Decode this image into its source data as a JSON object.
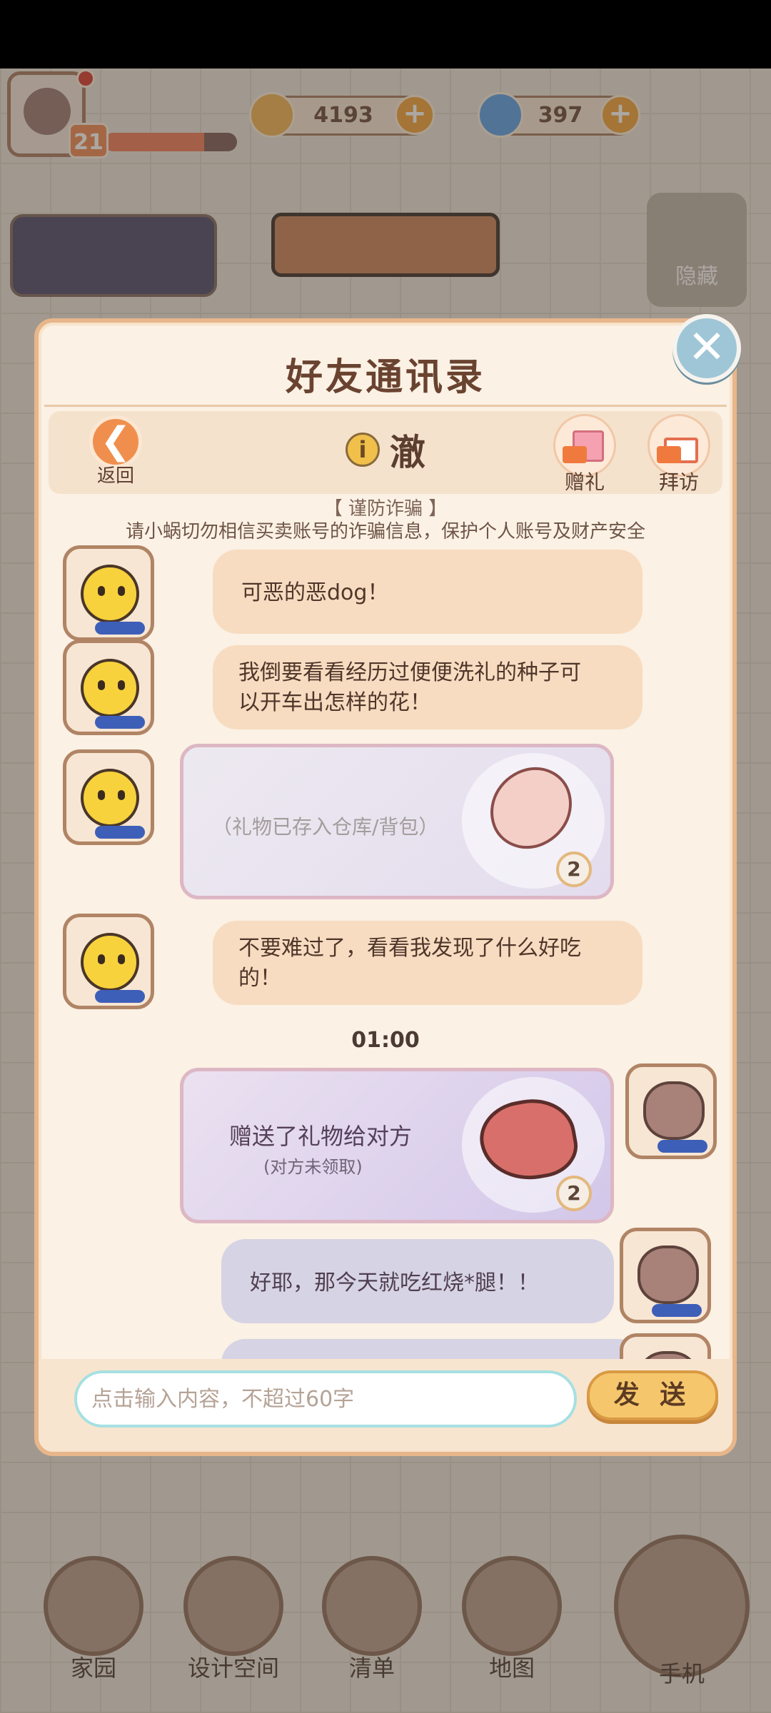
{
  "status": {},
  "player": {
    "level": "21",
    "level_progress": 0.75
  },
  "currency": {
    "coins": "4193",
    "gems": "397"
  },
  "background": {
    "hide_label": "隐藏",
    "nav": [
      {
        "label": "家园"
      },
      {
        "label": "设计空间"
      },
      {
        "label": "清单"
      },
      {
        "label": "地图"
      },
      {
        "label": "手机"
      }
    ]
  },
  "dialog": {
    "title": "好友通讯录",
    "back_label": "返回",
    "info_icon": "i",
    "friend_name": "澈",
    "gift_label": "赠礼",
    "visit_label": "拜访",
    "warning_title": "【 谨防诈骗 】",
    "warning_text": "请小蜗切勿相信买卖账号的诈骗信息，保护个人账号及财产安全",
    "close_icon": "✕",
    "back_icon": "❮"
  },
  "messages": [
    {
      "from": "friend",
      "type": "text",
      "text": "可恶的恶dog！"
    },
    {
      "from": "friend",
      "type": "text",
      "line1": "我倒要看看经历过便便洗礼的种子可",
      "line2": "以开车出怎样的花！"
    },
    {
      "from": "friend",
      "type": "gift",
      "text": "（礼物已存入仓库/背包）",
      "item": "drumstick",
      "qty": "2"
    },
    {
      "from": "friend",
      "type": "text",
      "line1": "不要难过了，看看我发现了什么好吃",
      "line2": "的！"
    },
    {
      "from": "me",
      "type": "gift",
      "text": "赠送了礼物给对方",
      "sub": "(对方未领取)",
      "item": "steak",
      "qty": "2"
    },
    {
      "from": "me",
      "type": "text",
      "text": "好耶，那今天就吃红烧*腿！！"
    }
  ],
  "time_separator": "01:00",
  "composer": {
    "placeholder": "点击输入内容，不超过60字",
    "value": "",
    "send_label": "发 送"
  },
  "colors": {
    "panel": "#fbf1e4",
    "panel_border": "#e7b68a",
    "friend_bubble": "#f7dcc1",
    "my_bubble": "#d6d3e4",
    "send_button": "#f6c66c",
    "close_button": "#9fc6d6"
  }
}
